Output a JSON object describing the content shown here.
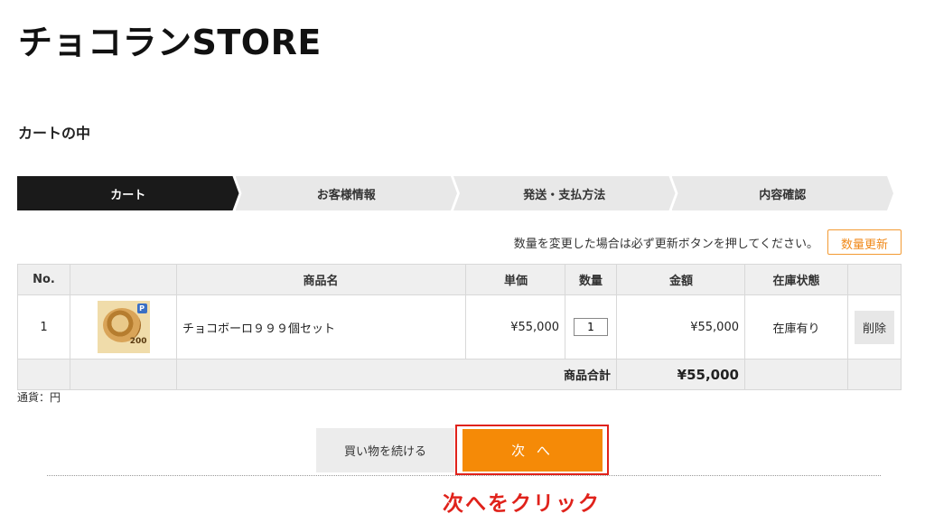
{
  "store": {
    "title": "チョコランSTORE"
  },
  "page": {
    "section_title": "カートの中"
  },
  "steps": [
    {
      "label": "カート",
      "active": true
    },
    {
      "label": "お客様情報",
      "active": false
    },
    {
      "label": "発送・支払方法",
      "active": false
    },
    {
      "label": "内容確認",
      "active": false
    }
  ],
  "notice": {
    "text": "数量を変更した場合は必ず更新ボタンを押してください。",
    "update_button": "数量更新"
  },
  "table": {
    "headers": {
      "no": "No.",
      "image": "",
      "name": "商品名",
      "price": "単価",
      "qty": "数量",
      "amount": "金額",
      "stock": "在庫状態",
      "action": ""
    },
    "rows": [
      {
        "no": "1",
        "thumb_badge": "P",
        "thumb_number": "200",
        "name": "チョコボーロ９９９個セット",
        "price": "¥55,000",
        "qty": "1",
        "amount": "¥55,000",
        "stock": "在庫有り",
        "delete_label": "削除"
      }
    ],
    "total_label": "商品合計",
    "total_value": "¥55,000"
  },
  "currency_note": "通貨：円",
  "buttons": {
    "continue": "買い物を続ける",
    "next": "次 へ"
  },
  "annotation": {
    "text": "次へをクリック",
    "color": "#e0221b"
  },
  "colors": {
    "accent": "#f58a07",
    "active_step": "#1a1a1a",
    "highlight": "#e0221b"
  }
}
